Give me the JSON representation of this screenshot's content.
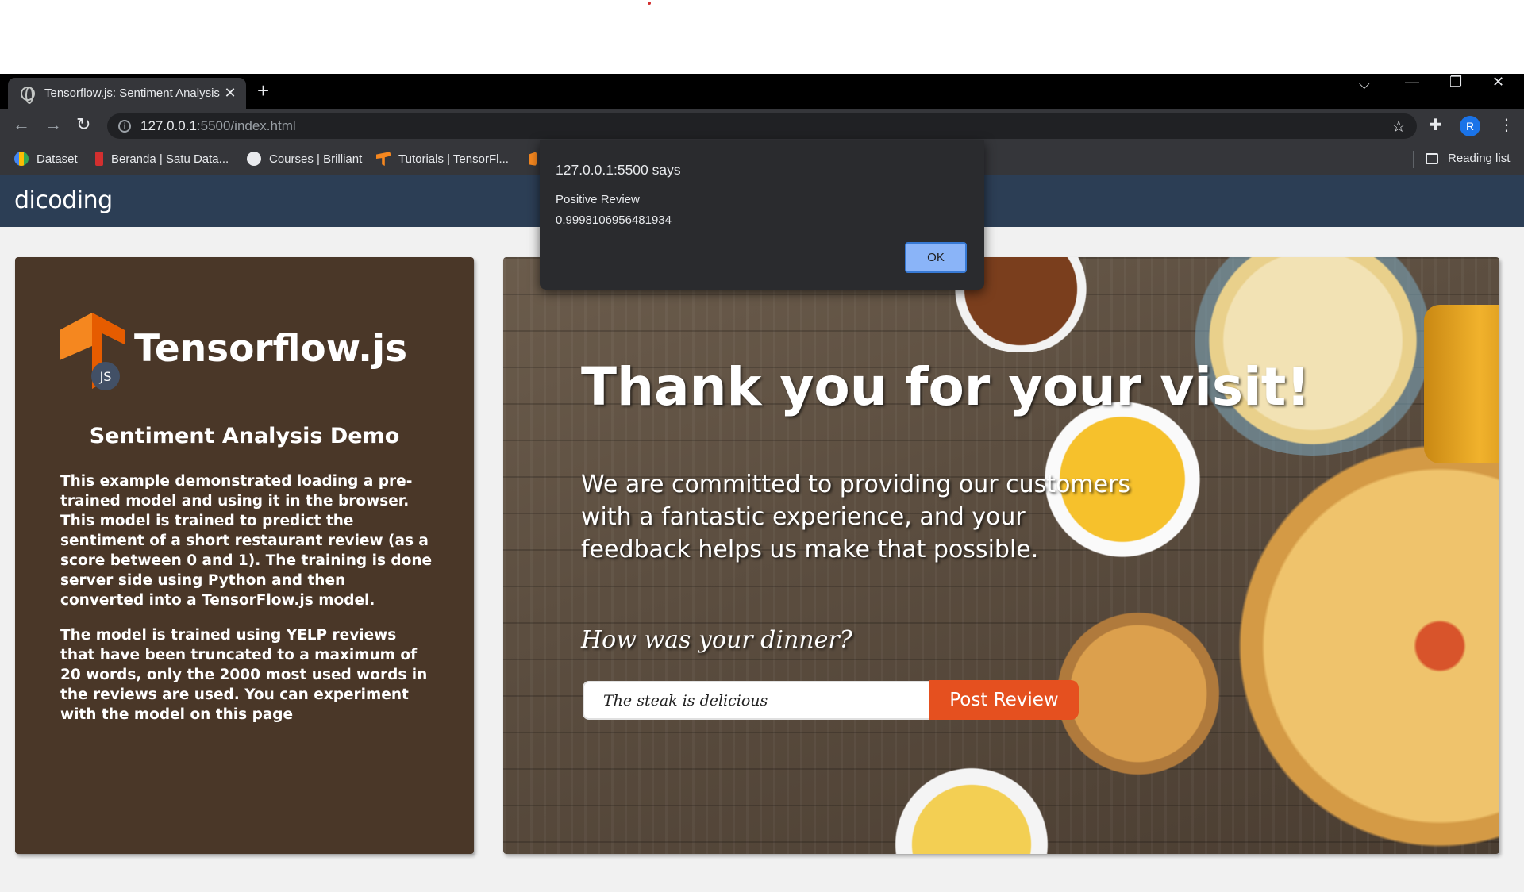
{
  "browser": {
    "tab_title": "Tensorflow.js: Sentiment Analysis",
    "tab_close": "✕",
    "new_tab": "+",
    "url_host": "127.0.0.1",
    "url_path": ":5500/index.html",
    "bookmarks": [
      {
        "label": "Dataset"
      },
      {
        "label": "Beranda | Satu Data..."
      },
      {
        "label": "Courses | Brilliant"
      },
      {
        "label": "Tutorials  |  TensorFl..."
      }
    ],
    "reading_list": "Reading list",
    "avatar": "R"
  },
  "site": {
    "logo": "dicoding"
  },
  "sidebar": {
    "title": "Tensorflow.js",
    "logo_badge": "JS",
    "subtitle": "Sentiment Analysis Demo",
    "paragraph1": "This example demonstrated loading a pre-trained model and using it in the browser. This model is trained to predict the sentiment of a short restaurant review (as a score between 0 and 1). The training is done server side using Python and then converted into a TensorFlow.js model.",
    "paragraph2": "The model is trained using YELP reviews that have been truncated to a maximum of 20 words, only the 2000 most used words in the reviews are used. You can experiment with the model on this page"
  },
  "hero": {
    "title": "Thank you for your visit!",
    "subtitle": "We are committed to providing our customers with a fantastic experience, and your feedback helps us make that possible.",
    "question": "How was your dinner?",
    "input_value": "The steak is delicious",
    "button_label": "Post Review"
  },
  "dialog": {
    "title": "127.0.0.1:5500 says",
    "line1": "Positive Review",
    "line2": "0.9998106956481934",
    "ok_label": "OK"
  },
  "colors": {
    "header_bg": "#2c3e55",
    "sidebar_bg": "#4a3728",
    "button_bg": "#e5501f",
    "dialog_ok": "#8ab4f8"
  }
}
